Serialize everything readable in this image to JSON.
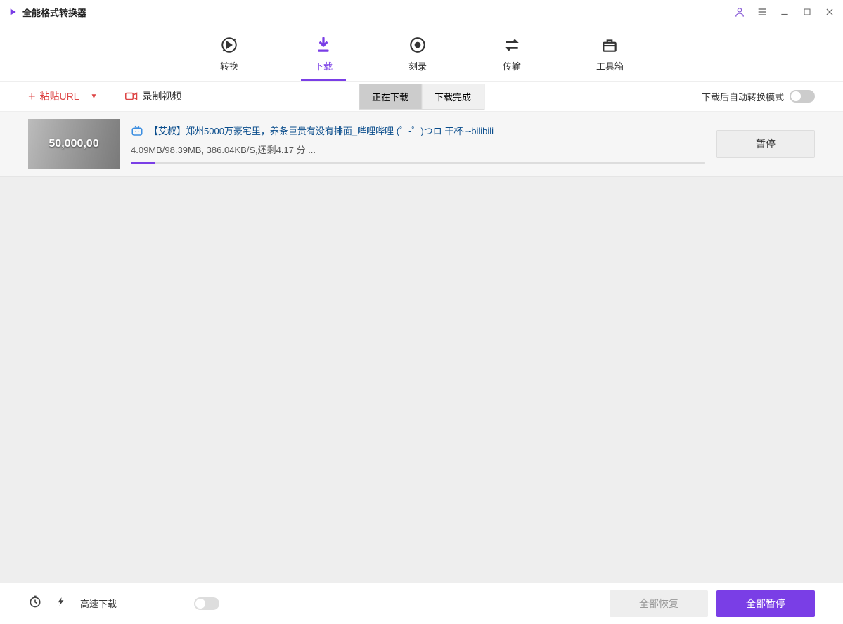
{
  "app_title": "全能格式转换器",
  "nav": {
    "items": [
      {
        "label": "转换"
      },
      {
        "label": "下载"
      },
      {
        "label": "刻录"
      },
      {
        "label": "传输"
      },
      {
        "label": "工具箱"
      }
    ]
  },
  "toolbar": {
    "paste_url": "粘贴URL",
    "record": "录制视频",
    "downloading_tab": "正在下载",
    "completed_tab": "下载完成",
    "auto_convert_label": "下载后自动转换模式"
  },
  "downloads": [
    {
      "title": "【艾叔】郑州5000万豪宅里，养条巨贵有没有排面_哔哩哔哩 (゜-゜)つロ 干杯~-bilibili",
      "status": "4.09MB/98.39MB, 386.04KB/S,还剩4.17 分 ...",
      "progress_pct": 4.2,
      "thumb_text": "50,000,00",
      "pause_label": "暂停"
    }
  ],
  "bottom": {
    "speed_label": "高速下载",
    "resume_all": "全部恢复",
    "pause_all": "全部暂停"
  }
}
